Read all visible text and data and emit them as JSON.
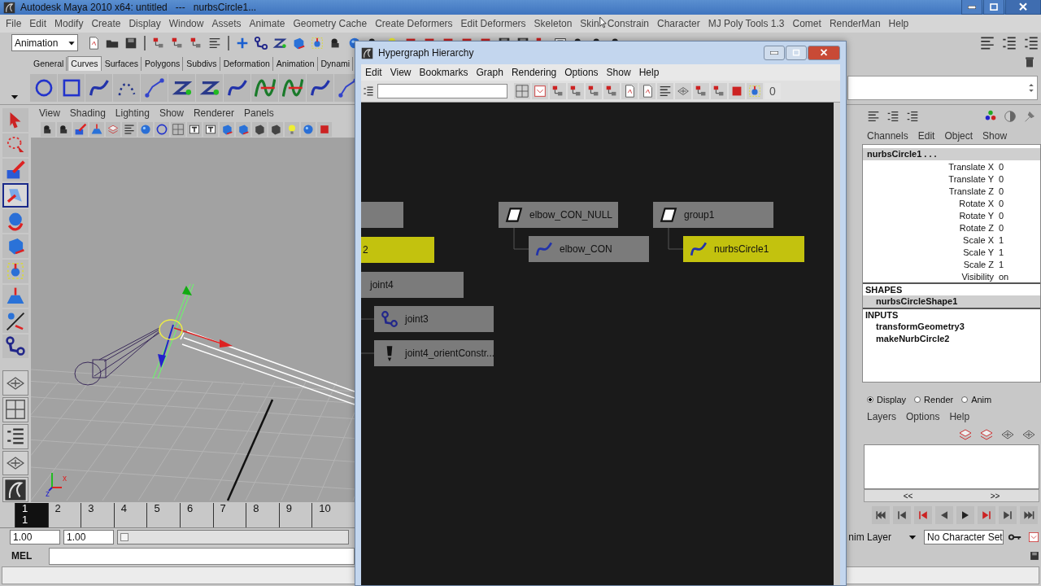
{
  "window": {
    "title": "Autodesk Maya 2010 x64: untitled   ---   nurbsCircle1..."
  },
  "menu": [
    "File",
    "Edit",
    "Modify",
    "Create",
    "Display",
    "Window",
    "Assets",
    "Animate",
    "Geometry Cache",
    "Create Deformers",
    "Edit Deformers",
    "Skeleton",
    "Skin",
    "Constrain",
    "Character",
    "MJ Poly Tools 1.3",
    "Comet",
    "RenderMan",
    "Help"
  ],
  "status_line": {
    "menu_set": "Animation"
  },
  "shelf_tabs": [
    {
      "label": "General",
      "selected": false
    },
    {
      "label": "Curves",
      "selected": true
    },
    {
      "label": "Surfaces",
      "selected": false
    },
    {
      "label": "Polygons",
      "selected": false
    },
    {
      "label": "Subdivs",
      "selected": false
    },
    {
      "label": "Deformation",
      "selected": false
    },
    {
      "label": "Animation",
      "selected": false
    },
    {
      "label": "Dynami",
      "selected": false
    }
  ],
  "toolbox": [
    {
      "selected": false
    },
    {
      "selected": false
    },
    {
      "selected": false
    },
    {
      "selected": true
    },
    {
      "selected": false
    },
    {
      "selected": false
    },
    {
      "selected": false
    },
    {
      "selected": false
    },
    {
      "selected": false
    },
    {
      "selected": false
    }
  ],
  "viewport": {
    "menu": [
      "View",
      "Shading",
      "Lighting",
      "Show",
      "Renderer",
      "Panels"
    ],
    "axis_labels": [
      "x",
      "z"
    ]
  },
  "hypergraph": {
    "title": "Hypergraph Hierarchy",
    "menu": [
      "Edit",
      "View",
      "Bookmarks",
      "Graph",
      "Rendering",
      "Options",
      "Show",
      "Help"
    ],
    "toolbar_counter": "0",
    "nodes": [
      {
        "selected": false
      },
      {
        "label": "2",
        "selected": true
      },
      {
        "label": "joint4",
        "selected": false
      },
      {
        "label": "joint3",
        "kind": "joint",
        "selected": false
      },
      {
        "label": "joint4_orientConstr...",
        "kind": "constraint",
        "selected": false
      },
      {
        "label": "elbow_CON_NULL",
        "kind": "transform",
        "selected": false,
        "children": [
          {
            "label": "elbow_CON",
            "kind": "curve",
            "selected": false
          }
        ]
      },
      {
        "label": "group1",
        "kind": "transform",
        "selected": false,
        "children": [
          {
            "label": "nurbsCircle1",
            "kind": "curve",
            "selected": true
          }
        ]
      }
    ]
  },
  "channel_box": {
    "menu": [
      "Channels",
      "Edit",
      "Object",
      "Show"
    ],
    "object": "nurbsCircle1 . . .",
    "attributes": [
      {
        "name": "Translate X",
        "value": "0"
      },
      {
        "name": "Translate Y",
        "value": "0"
      },
      {
        "name": "Translate Z",
        "value": "0"
      },
      {
        "name": "Rotate X",
        "value": "0"
      },
      {
        "name": "Rotate Y",
        "value": "0"
      },
      {
        "name": "Rotate Z",
        "value": "0"
      },
      {
        "name": "Scale X",
        "value": "1"
      },
      {
        "name": "Scale Y",
        "value": "1"
      },
      {
        "name": "Scale Z",
        "value": "1"
      },
      {
        "name": "Visibility",
        "value": "on"
      }
    ],
    "shapes_header": "SHAPES",
    "shapes": [
      {
        "label": "nurbsCircleShape1",
        "selected": true
      }
    ],
    "inputs_header": "INPUTS",
    "inputs": [
      "transformGeometry3",
      "makeNurbCircle2"
    ]
  },
  "layer_editor": {
    "modes": [
      {
        "label": "Display",
        "selected": true
      },
      {
        "label": "Render",
        "selected": false
      },
      {
        "label": "Anim",
        "selected": false
      }
    ],
    "menu": [
      "Layers",
      "Options",
      "Help"
    ],
    "scroll_labels": [
      "<<",
      ">>"
    ]
  },
  "timeline": {
    "frames": [
      {
        "label": "1",
        "selected": true
      },
      {
        "label": "2",
        "selected": false
      },
      {
        "label": "3",
        "selected": false
      },
      {
        "label": "4",
        "selected": false
      },
      {
        "label": "5",
        "selected": false
      },
      {
        "label": "6",
        "selected": false
      },
      {
        "label": "7",
        "selected": false
      },
      {
        "label": "8",
        "selected": false
      },
      {
        "label": "9",
        "selected": false
      },
      {
        "label": "10",
        "selected": false
      }
    ],
    "current_frame": "1"
  },
  "range": {
    "start": "1.00",
    "current": "1.00",
    "level": 0
  },
  "anim_layer": "nim Layer",
  "character_set": "No Character Set",
  "command_line": {
    "label": "MEL"
  }
}
